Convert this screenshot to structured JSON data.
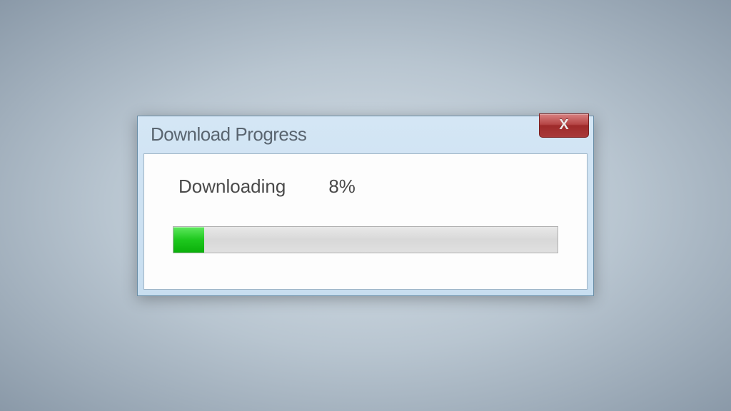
{
  "dialog": {
    "title": "Download Progress",
    "status_label": "Downloading",
    "percent_text": "8%",
    "percent_value": 8
  }
}
